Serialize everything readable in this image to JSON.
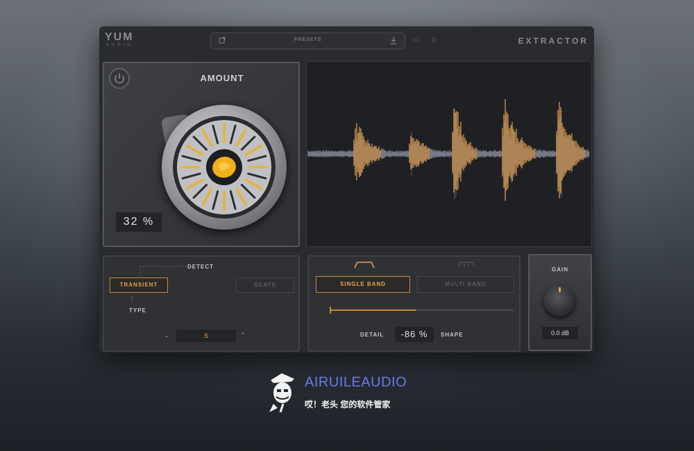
{
  "header": {
    "logo_main": "YUM",
    "logo_sub": "AUDIO",
    "preset_label": "PRESETS",
    "brand": "EXTRACTOR"
  },
  "amount": {
    "title": "AMOUNT",
    "value": "32",
    "unit": "%",
    "level": 0.32
  },
  "detect": {
    "detect_label": "DETECT",
    "transient_label": "TRANSIENT",
    "beats_label": "BEATS",
    "type_label": "TYPE",
    "type_value": "S",
    "active": "TRANSIENT"
  },
  "band": {
    "single_label": "SINGLE BAND",
    "multi_label": "MULTI BAND",
    "active": "SINGLE BAND",
    "detail_label": "DETAIL",
    "detail_value": "-86",
    "detail_unit": "%",
    "shape_label": "SHAPE"
  },
  "gain": {
    "title": "GAIN",
    "value": "0.0",
    "unit": "dB"
  },
  "watermark": {
    "title": "AIRUILEAUDIO",
    "subtitle": "哎！老头 您的软件管家"
  },
  "colors": {
    "accent": "#e8a24a",
    "panel": "#303134",
    "background": "#2a2b2e",
    "waveform_secondary": "#6a6f86",
    "watermark_blue": "#6b79e8"
  }
}
